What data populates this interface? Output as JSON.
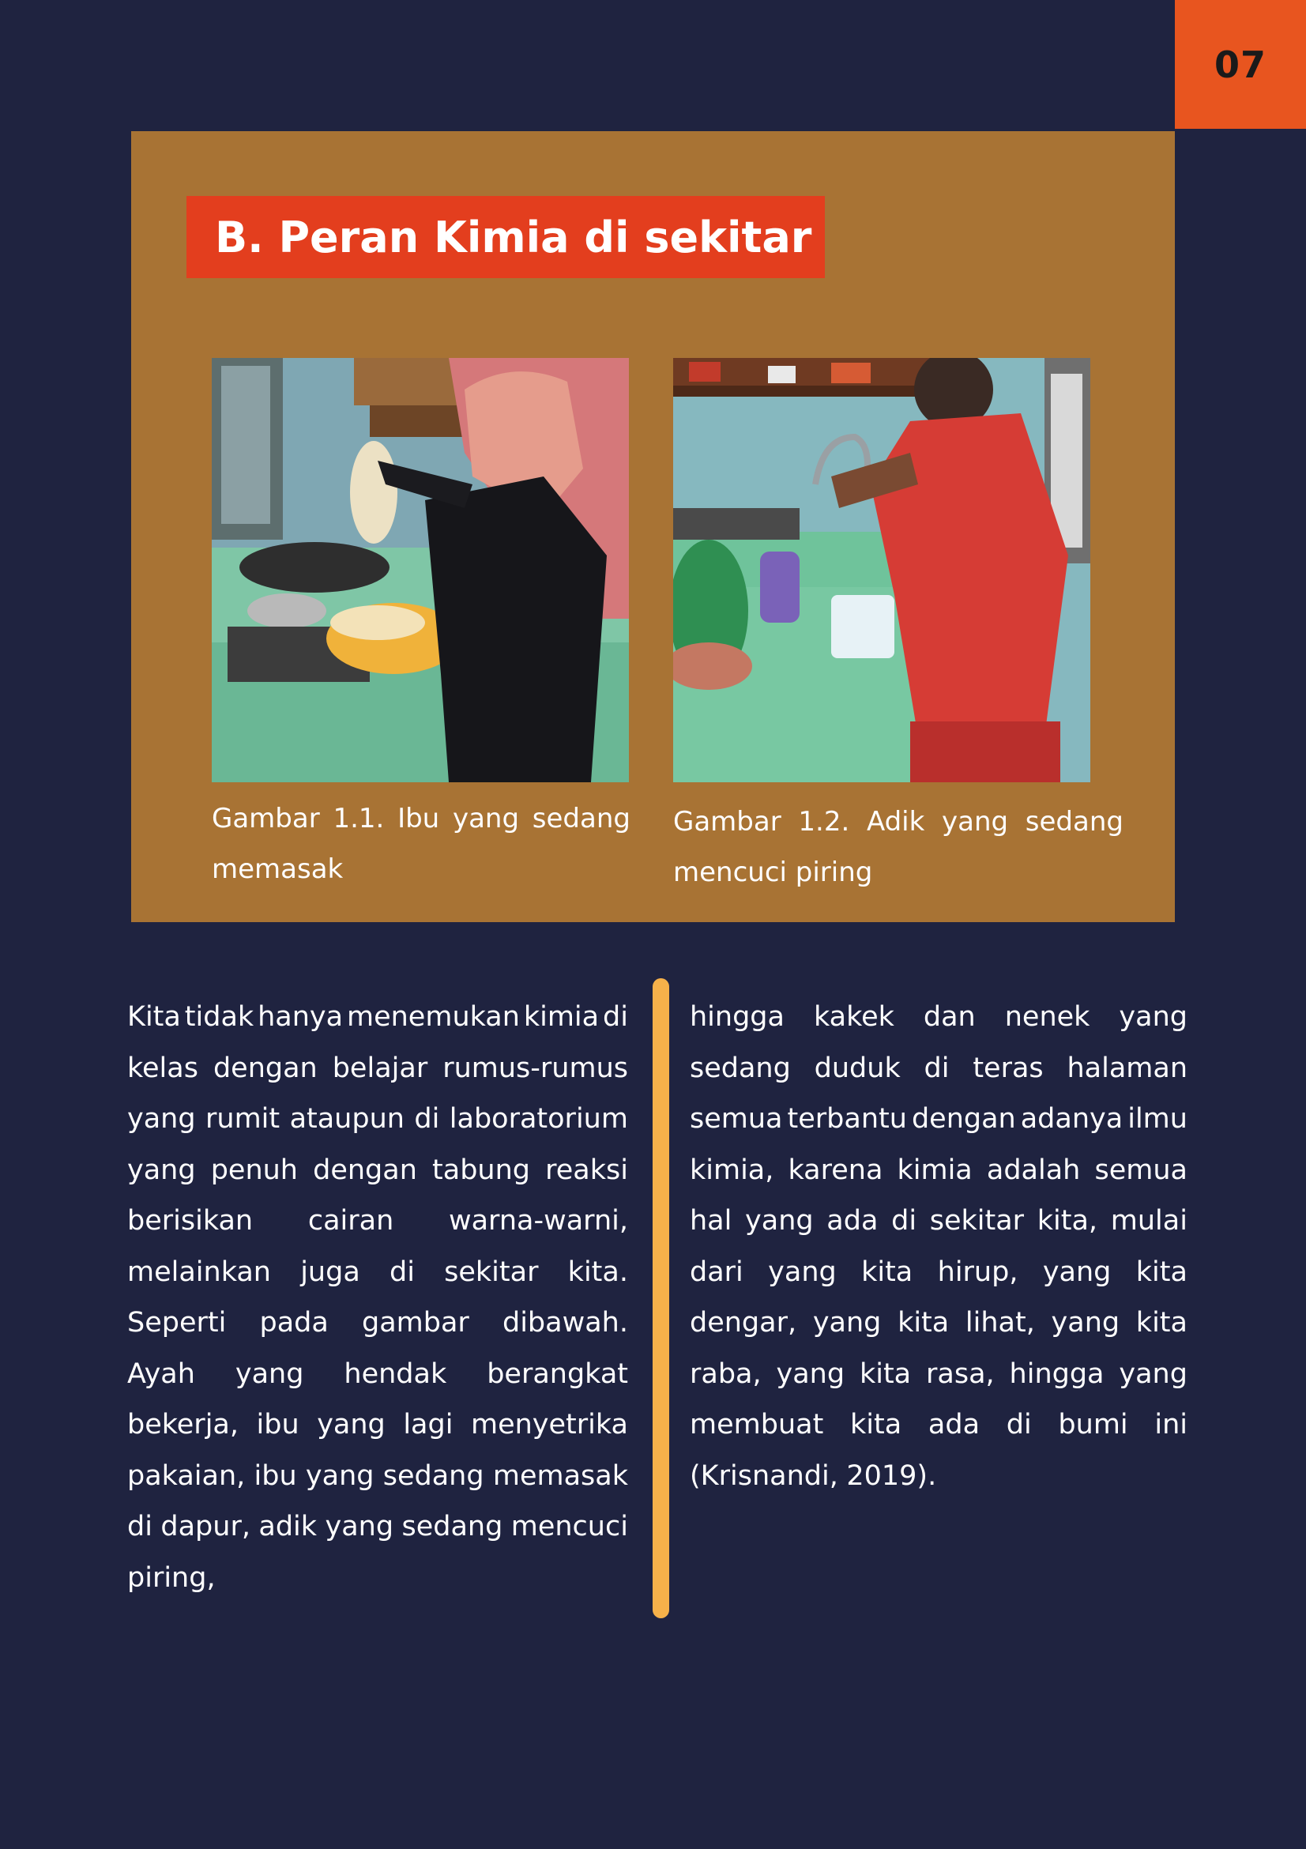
{
  "page": {
    "number": "07"
  },
  "section": {
    "heading": "B. Peran Kimia di sekitar"
  },
  "figures": [
    {
      "caption_line1": [
        "Gambar",
        "1.1.",
        "Ibu",
        "yang",
        "sedang"
      ],
      "caption_line2": "memasak"
    },
    {
      "caption_line1": [
        "Gambar",
        "1.2.",
        "Adik",
        "yang",
        "sedang"
      ],
      "caption_line2": "mencuci piring"
    }
  ],
  "body": {
    "left_lines": [
      "Kita tidak hanya menemukan kimia di",
      "kelas dengan belajar rumus-rumus",
      "yang rumit ataupun di laboratorium",
      "yang penuh dengan tabung reaksi",
      "berisikan cairan warna-warni,",
      "melainkan juga di sekitar kita.",
      "Seperti pada gambar dibawah.",
      "Ayah yang hendak berangkat",
      "bekerja, ibu yang lagi menyetrika",
      "pakaian, ibu yang sedang memasak",
      "di dapur, adik yang sedang mencuci",
      "piring,"
    ],
    "right_lines": [
      "hingga kakek dan nenek yang",
      "sedang duduk di teras halaman",
      "semua terbantu dengan adanya ilmu",
      "kimia, karena kimia adalah semua",
      "hal yang ada di sekitar kita, mulai",
      "dari yang kita hirup, yang kita",
      "dengar, yang kita lihat, yang kita",
      "raba, yang kita rasa, hingga yang",
      "membuat kita ada di bumi ini",
      "(Krisnandi, 2019)."
    ]
  },
  "colors": {
    "background": "#1f2340",
    "panel": "#a87334",
    "heading_box": "#e33e1e",
    "page_number_box": "#e8551f",
    "divider": "#f6b14a"
  }
}
